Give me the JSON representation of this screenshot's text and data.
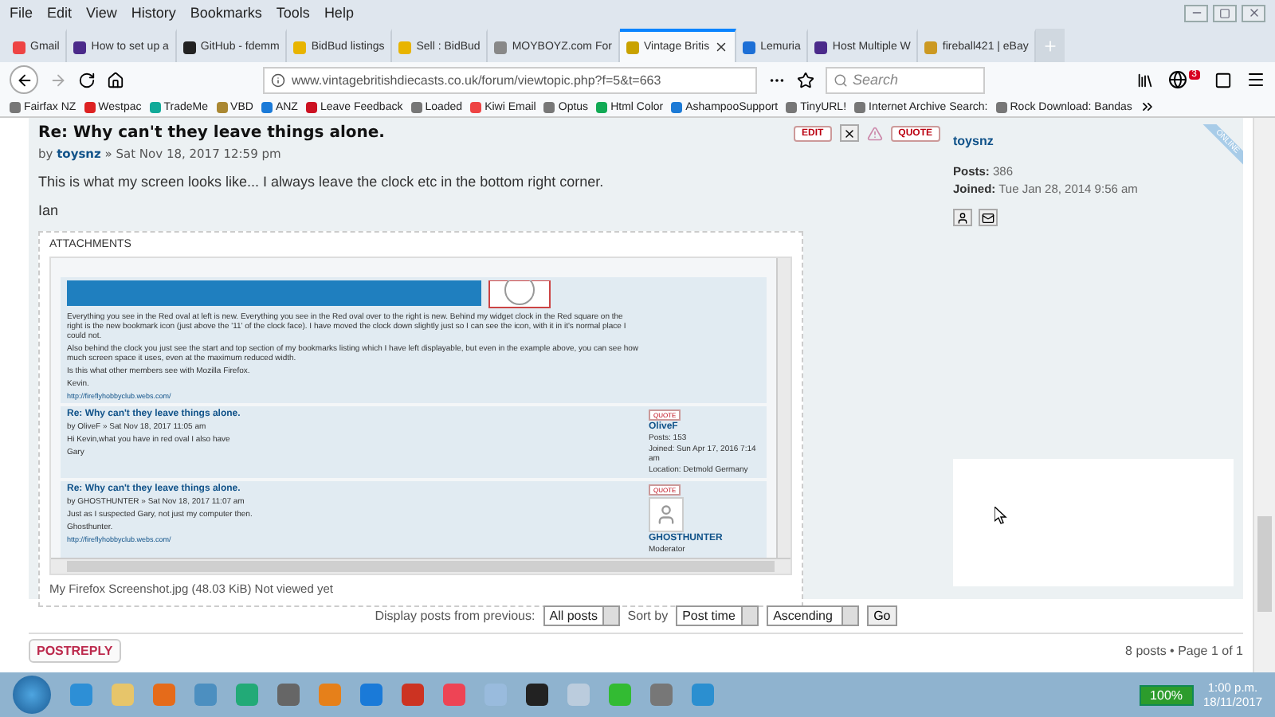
{
  "menu": [
    "File",
    "Edit",
    "View",
    "History",
    "Bookmarks",
    "Tools",
    "Help"
  ],
  "tabs": [
    {
      "label": "Gmail",
      "selected": false
    },
    {
      "label": "How to set up a",
      "selected": false
    },
    {
      "label": "GitHub - fdemm",
      "selected": false
    },
    {
      "label": "BidBud listings",
      "selected": false
    },
    {
      "label": "Sell : BidBud",
      "selected": false
    },
    {
      "label": "MOYBOYZ.com For",
      "selected": false
    },
    {
      "label": "Vintage Britis",
      "selected": true
    },
    {
      "label": "Lemuria",
      "selected": false
    },
    {
      "label": "Host Multiple W",
      "selected": false
    },
    {
      "label": "fireball421 | eBay",
      "selected": false
    }
  ],
  "address": {
    "url": "www.vintagebritishdiecasts.co.uk/forum/viewtopic.php?f=5&t=663"
  },
  "search": {
    "placeholder": "Search"
  },
  "notification_badge": "3",
  "bookmarks": [
    "Fairfax NZ",
    "Westpac",
    "TradeMe",
    "VBD",
    "ANZ",
    "Leave Feedback",
    "Loaded",
    "Kiwi Email",
    "Optus",
    "Html Color",
    "AshampooSupport",
    "TinyURL!",
    "Internet Archive Search:",
    "Rock Download: Bandas"
  ],
  "post": {
    "title": "Re: Why can't they leave things alone.",
    "by": "by",
    "author": "toysnz",
    "date": "» Sat Nov 18, 2017 12:59 pm",
    "actions": [
      {
        "kind": "text",
        "label": "EDIT"
      },
      {
        "kind": "delete"
      },
      {
        "kind": "report"
      },
      {
        "kind": "text",
        "label": "QUOTE"
      }
    ],
    "body": "This is what my screen looks like... I always leave the clock etc in the bottom right corner.",
    "signature": "Ian",
    "attachments_label": "ATTACHMENTS",
    "file_caption": "My Firefox Screenshot.jpg (48.03 KiB) Not viewed yet"
  },
  "attachment_posts": [
    {
      "kind": "continued",
      "paragraphs": [
        "Everything you see in the Red oval at left is new. Everything you see in the Red oval over to the right is new. Behind my widget clock in the Red square on the right is the new bookmark icon (just above the '11' of the clock face). I have moved the clock down slightly just so I can see the icon, with it in it's normal place I could not.",
        "Also behind the clock you just see the start and top section of my bookmarks listing which I have left displayable, but even in the example above, you can see how much screen space it uses, even at the maximum reduced width.",
        "Is this what other members see with Mozilla Firefox.",
        "Kevin."
      ],
      "link": "http://fireflyhobbyclub.webs.com/"
    },
    {
      "kind": "reply",
      "title": "Re: Why can't they leave things alone.",
      "byline": "by OliveF » Sat Nov 18, 2017 11:05 am",
      "paragraphs": [
        "Hi Kevin,what you have in red oval I also have",
        "Gary"
      ],
      "action": "QUOTE",
      "profile_name": "OliveF",
      "profile_lines": [
        "Posts: 153",
        "Joined: Sun Apr 17, 2016 7:14 am",
        "Location: Detmold Germany"
      ]
    },
    {
      "kind": "reply",
      "title": "Re: Why can't they leave things alone.",
      "byline": "by GHOSTHUNTER » Sat Nov 18, 2017 11:07 am",
      "paragraphs": [
        "Just as I suspected Gary, not just my computer then.",
        "Ghosthunter."
      ],
      "link": "http://fireflyhobbyclub.webs.com/",
      "action": "QUOTE",
      "avatar": true,
      "profile_name": "GHOSTHUNTER",
      "profile_lines": [
        "Moderator"
      ]
    }
  ],
  "profile": {
    "username": "toysnz",
    "status": "ONLINE",
    "stats": [
      {
        "label": "Posts:",
        "value": "386"
      },
      {
        "label": "Joined:",
        "value": "Tue Jan 28, 2014 9:56 am"
      }
    ]
  },
  "display": {
    "label": "Display posts from previous:",
    "range": "All posts",
    "sort_label": "Sort by",
    "sort": "Post time",
    "order": "Ascending",
    "go": "Go"
  },
  "post_reply": "POSTREPLY",
  "pagination": "8 posts • Page 1 of 1",
  "taskbar": {
    "battery": "100%",
    "time": "1:00 p.m.",
    "date": "18/11/2017"
  }
}
